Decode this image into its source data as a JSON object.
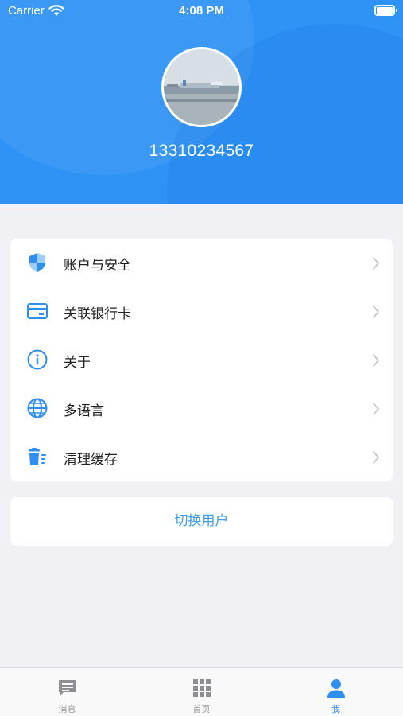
{
  "status_bar": {
    "carrier": "Carrier",
    "time": "4:08 PM"
  },
  "profile": {
    "phone": "13310234567"
  },
  "menu": {
    "items": [
      {
        "label": "账户与安全",
        "icon": "shield-icon"
      },
      {
        "label": "关联银行卡",
        "icon": "bank-card-icon"
      },
      {
        "label": "关于",
        "icon": "info-icon"
      },
      {
        "label": "多语言",
        "icon": "globe-icon"
      },
      {
        "label": "清理缓存",
        "icon": "trash-icon"
      }
    ]
  },
  "switch_user": {
    "label": "切换用户"
  },
  "tabbar": {
    "tabs": [
      {
        "label": "消息",
        "icon": "message-icon",
        "active": false
      },
      {
        "label": "首页",
        "icon": "grid-icon",
        "active": false
      },
      {
        "label": "我",
        "icon": "person-icon",
        "active": true
      }
    ]
  },
  "colors": {
    "primary": "#2f93f5",
    "accent": "#3a9df0",
    "background": "#f0f0f5"
  }
}
